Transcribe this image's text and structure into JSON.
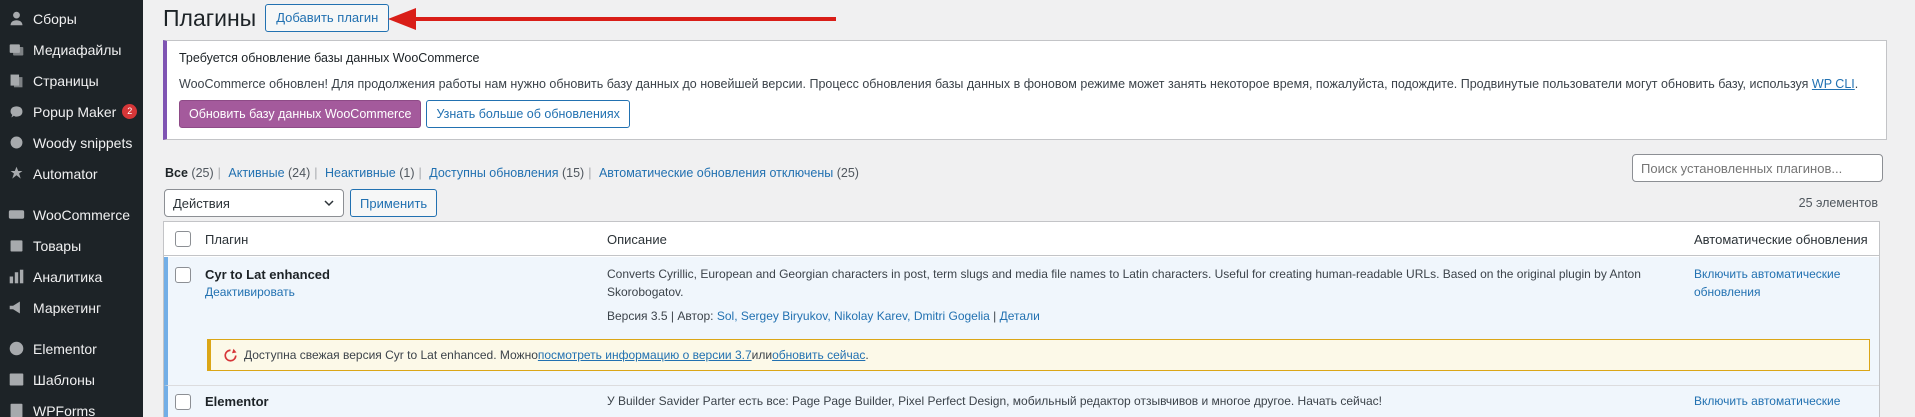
{
  "sidebar": {
    "items": [
      {
        "label": "Сборы",
        "icon": "person-icon"
      },
      {
        "label": "Медиафайлы",
        "icon": "media-icon"
      },
      {
        "label": "Страницы",
        "icon": "pages-icon"
      },
      {
        "label": "Popup Maker",
        "icon": "popup-icon",
        "badge": "2"
      },
      {
        "label": "Woody snippets",
        "icon": "snippet-icon"
      },
      {
        "label": "Automator",
        "icon": "automator-icon"
      },
      {
        "label": "WooCommerce",
        "icon": "woocommerce-icon"
      },
      {
        "label": "Товары",
        "icon": "products-icon"
      },
      {
        "label": "Аналитика",
        "icon": "analytics-icon"
      },
      {
        "label": "Маркетинг",
        "icon": "marketing-icon"
      },
      {
        "label": "Elementor",
        "icon": "elementor-icon"
      },
      {
        "label": "Шаблоны",
        "icon": "templates-icon"
      },
      {
        "label": "WPForms",
        "icon": "wpforms-icon"
      }
    ]
  },
  "header": {
    "title": "Плагины",
    "add_button": "Добавить плагин"
  },
  "notice": {
    "title": "Требуется обновление базы данных WooCommerce",
    "text": "WooCommerce обновлен! Для продолжения работы нам нужно обновить базу данных до новейшей версии. Процесс обновления базы данных в фоновом режиме может занять некоторое время, пожалуйста, подождите. Продвинутые пользователи могут обновить базу, используя ",
    "link": "WP CLI",
    "text_end": ".",
    "primary_button": "Обновить базу данных WooCommerce",
    "secondary_button": "Узнать больше об обновлениях"
  },
  "filters": {
    "all": {
      "label": "Все",
      "count": "(25)"
    },
    "active": {
      "label": "Активные",
      "count": "(24)"
    },
    "inactive": {
      "label": "Неактивные",
      "count": "(1)"
    },
    "updates": {
      "label": "Доступны обновления",
      "count": "(15)"
    },
    "auto_off": {
      "label": "Автоматические обновления отключены",
      "count": "(25)"
    }
  },
  "search": {
    "placeholder": "Поиск установленных плагинов..."
  },
  "bulk": {
    "select_value": "Действия",
    "apply": "Применить",
    "count": "25 элементов"
  },
  "table": {
    "headers": {
      "plugin": "Плагин",
      "description": "Описание",
      "auto": "Автоматические обновления"
    },
    "rows": [
      {
        "name": "Cyr to Lat enhanced",
        "action": "Деактивировать",
        "description": "Converts Cyrillic, European and Georgian characters in post, term slugs and media file names to Latin characters. Useful for creating human-readable URLs. Based on the original plugin by Anton Skorobogatov.",
        "version": "Версия 3.5 | Автор: ",
        "authors": "Sol, Sergey Biryukov, Nikolay Karev, Dmitri Gogelia",
        "details_sep": " | ",
        "details": "Детали",
        "auto": "Включить автоматические обновления",
        "update_notice": {
          "text": "Доступна свежая версия Cyr to Lat enhanced. Можно ",
          "link1": "посмотреть информацию о версии 3.7",
          "middle": " или ",
          "link2": "обновить сейчас",
          "end": "."
        }
      },
      {
        "name": "Elementor",
        "description": "У Builder Savider Parter есть все: Page Page Builder, Pixel Perfect Design, мобильный редактор отзывчивов и многое другое. Начать сейчас!",
        "auto": "Включить автоматические"
      }
    ]
  },
  "colors": {
    "accent": "#2271b1",
    "woo_purple": "#a45a9c",
    "sidebar_bg": "#1d2327",
    "arrow": "#d91e18"
  }
}
